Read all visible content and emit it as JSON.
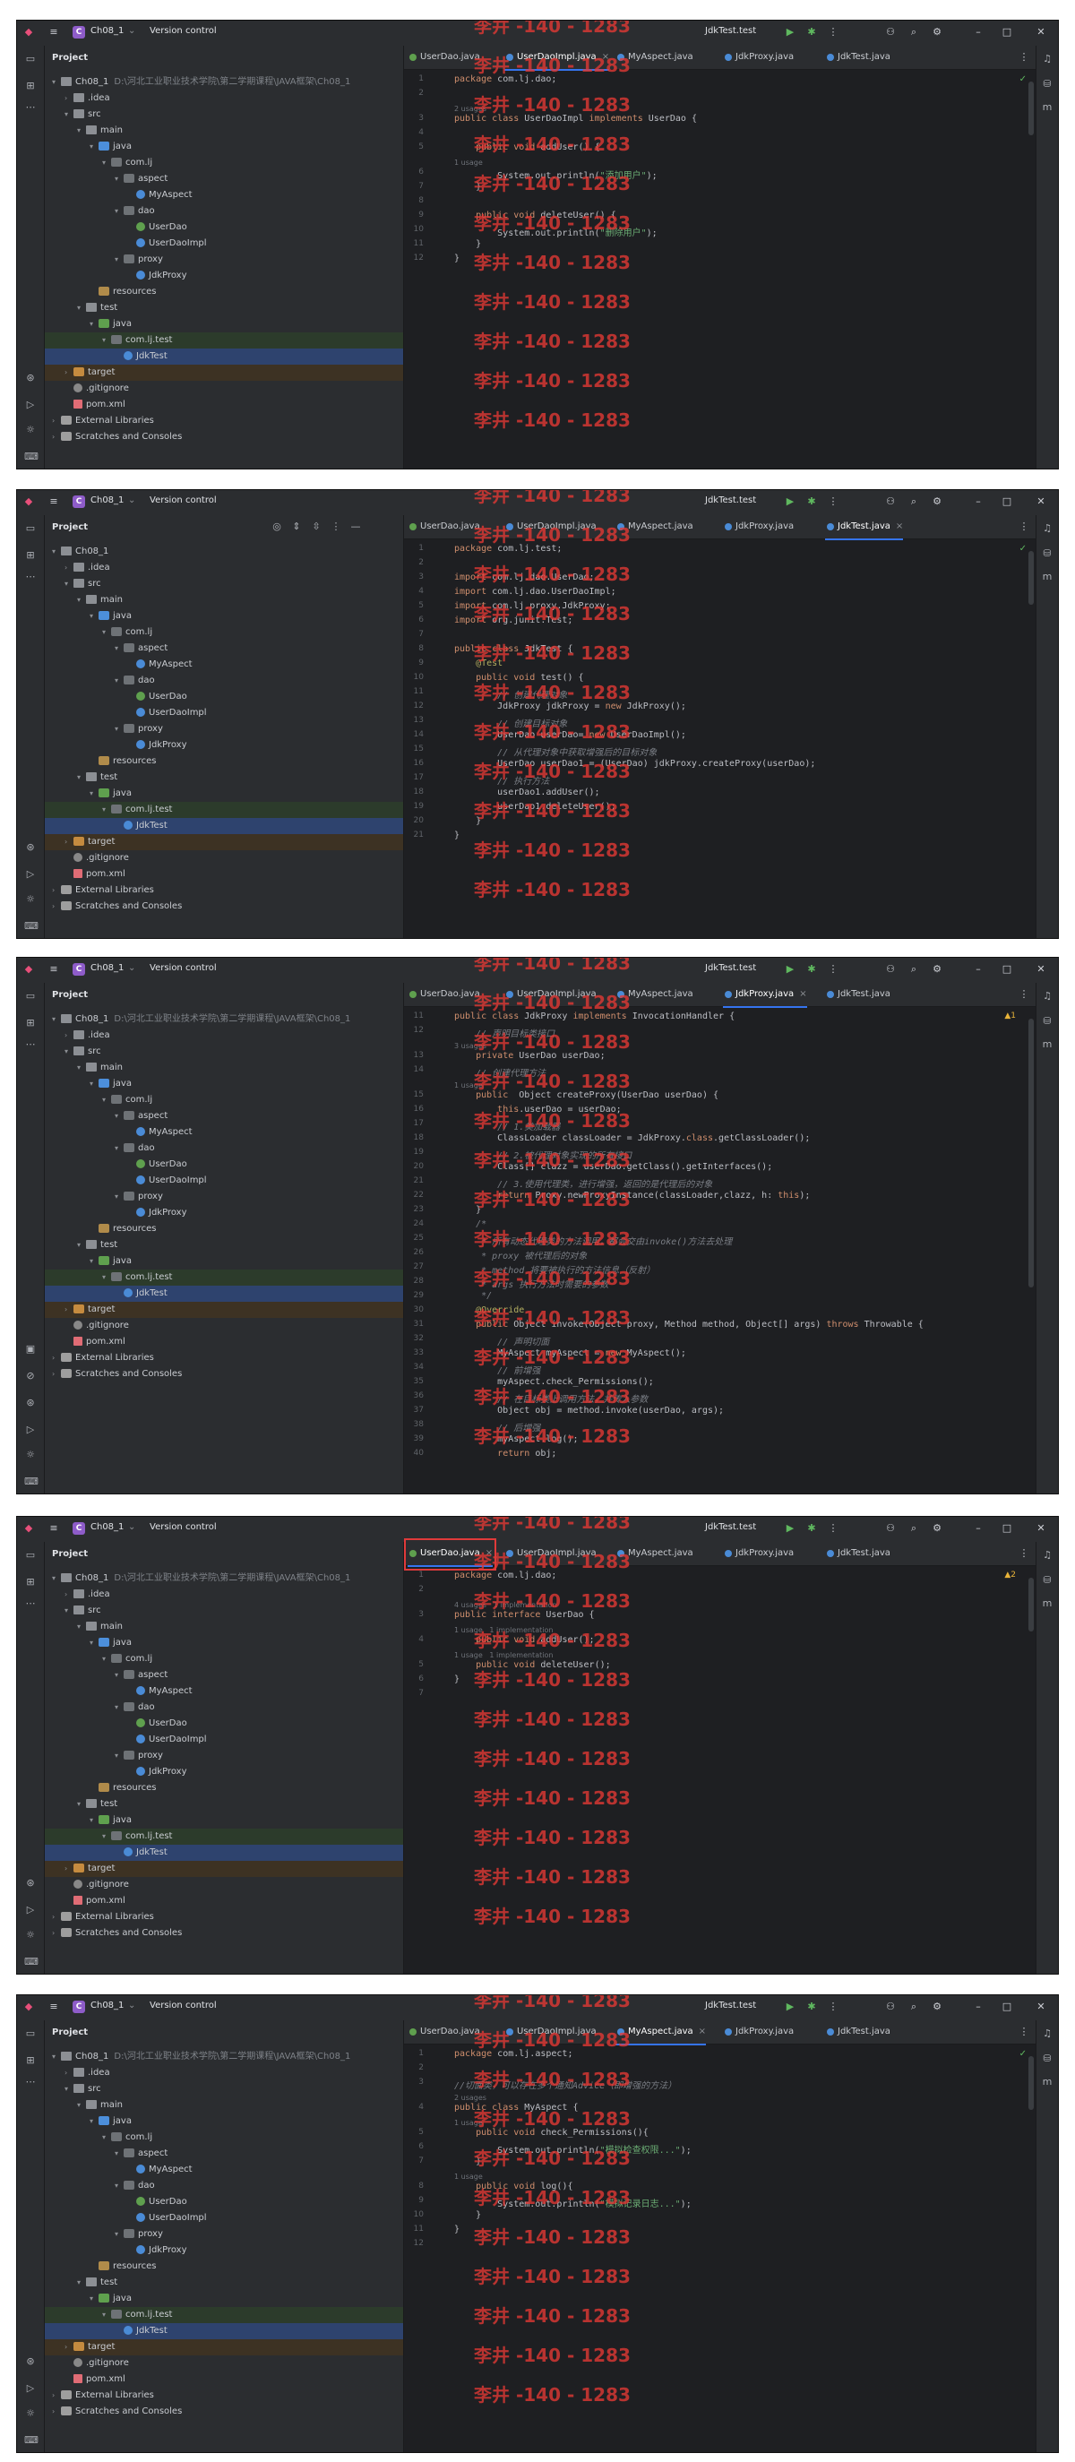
{
  "app": {
    "project_name": "Ch08_1",
    "project_badge": "C",
    "vcs_label": "Version control",
    "run_config": "JdkTest.test",
    "panel_title": "Project",
    "root_path": "D:\\河北工业职业技术学院\\第二学期课程\\JAVA框架\\Ch08_1"
  },
  "watermark": "李井 -140 - 1283",
  "tree": {
    "root": "Ch08_1",
    "idea": ".idea",
    "src": "src",
    "main": "main",
    "java": "java",
    "com_lj": "com.lj",
    "aspect": "aspect",
    "myaspect": "MyAspect",
    "dao": "dao",
    "userdao": "UserDao",
    "userdaoimpl": "UserDaoImpl",
    "proxy": "proxy",
    "jdkproxy": "JdkProxy",
    "resources": "resources",
    "test": "test",
    "test_java": "java",
    "com_lj_test": "com.lj.test",
    "jdktest": "JdkTest",
    "target": "target",
    "gitignore": ".gitignore",
    "pom": "pom.xml",
    "extlib": "External Libraries",
    "scratches": "Scratches and Consoles"
  },
  "tabs": [
    "UserDao.java",
    "UserDaoImpl.java",
    "MyAspect.java",
    "JdkProxy.java",
    "JdkTest.java"
  ],
  "panels": [
    {
      "active_tab": 1,
      "warn": "",
      "lines": [
        {
          "n": "1",
          "t": "package com.lj.dao;"
        },
        {
          "n": "2",
          "t": ""
        },
        {
          "hint": "2 usages"
        },
        {
          "n": "3",
          "t": "public class UserDaoImpl implements UserDao {"
        },
        {
          "n": "4",
          "t": ""
        },
        {
          "n": "5",
          "t": "    public void addUser() {"
        },
        {
          "hint": "1 usage"
        },
        {
          "n": "6",
          "t": "        System.out.println(\"添加用户\");"
        },
        {
          "n": "7",
          "t": "    }"
        },
        {
          "n": "8",
          "t": ""
        },
        {
          "n": "9",
          "t": "    public void deleteUser() {"
        },
        {
          "n": "10",
          "t": "        System.out.println(\"删除用户\");"
        },
        {
          "n": "11",
          "t": "    }"
        },
        {
          "n": "12",
          "t": "}"
        }
      ]
    },
    {
      "active_tab": 4,
      "warn": "",
      "lines": [
        {
          "n": "1",
          "t": "package com.lj.test;"
        },
        {
          "n": "2",
          "t": ""
        },
        {
          "n": "3",
          "t": "import com.lj.dao.UserDao;"
        },
        {
          "n": "4",
          "t": "import com.lj.dao.UserDaoImpl;"
        },
        {
          "n": "5",
          "t": "import com.lj.proxy.JdkProxy;"
        },
        {
          "n": "6",
          "t": "import org.junit.Test;"
        },
        {
          "n": "7",
          "t": ""
        },
        {
          "n": "8",
          "t": "public class JdkTest {"
        },
        {
          "n": "9",
          "t": "    @Test"
        },
        {
          "n": "10",
          "t": "    public void test() {"
        },
        {
          "n": "11",
          "t": "        // 创建代理对象"
        },
        {
          "n": "12",
          "t": "        JdkProxy jdkProxy = new JdkProxy();"
        },
        {
          "n": "13",
          "t": "        // 创建目标对象"
        },
        {
          "n": "14",
          "t": "        UserDao userDao= new UserDaoImpl();"
        },
        {
          "n": "15",
          "t": "        // 从代理对象中获取增强后的目标对象"
        },
        {
          "n": "16",
          "t": "        UserDao userDao1 = (UserDao) jdkProxy.createProxy(userDao);"
        },
        {
          "n": "17",
          "t": "        // 执行方法"
        },
        {
          "n": "18",
          "t": "        userDao1.addUser();"
        },
        {
          "n": "19",
          "t": "        userDao1.deleteUser();"
        },
        {
          "n": "20",
          "t": "    }"
        },
        {
          "n": "21",
          "t": "}"
        }
      ]
    },
    {
      "active_tab": 3,
      "warn": "▲1",
      "lines": [
        {
          "n": "11",
          "t": "public class JdkProxy implements InvocationHandler {"
        },
        {
          "n": "12",
          "t": "    // 声明目标类接口"
        },
        {
          "hint": "3 usages"
        },
        {
          "n": "13",
          "t": "    private UserDao userDao;"
        },
        {
          "n": "14",
          "t": "    // 创建代理方法"
        },
        {
          "hint": "1 usage"
        },
        {
          "n": "15",
          "t": "    public  Object createProxy(UserDao userDao) {"
        },
        {
          "n": "16",
          "t": "        this.userDao = userDao;"
        },
        {
          "n": "17",
          "t": "        // 1.类加载器"
        },
        {
          "n": "18",
          "t": "        ClassLoader classLoader = JdkProxy.class.getClassLoader();"
        },
        {
          "n": "19",
          "t": "        // 2.被代理对象实现的所有接口"
        },
        {
          "n": "20",
          "t": "        Class[] clazz = userDao.getClass().getInterfaces();"
        },
        {
          "n": "21",
          "t": "        // 3.使用代理类，进行增强，返回的是代理后的对象"
        },
        {
          "n": "22",
          "t": "        return Proxy.newProxyInstance(classLoader,clazz, h: this);"
        },
        {
          "n": "23",
          "t": "    }"
        },
        {
          "n": "24",
          "t": "    /*"
        },
        {
          "n": "25",
          "t": "     * 所有动态代理类的方法调用，都会交由invoke()方法去处理"
        },
        {
          "n": "26",
          "t": "     * proxy 被代理后的对象"
        },
        {
          "n": "27",
          "t": "     * method 将要被执行的方法信息（反射）"
        },
        {
          "n": "28",
          "t": "     * args 执行方法时需要的参数"
        },
        {
          "n": "29",
          "t": "     */"
        },
        {
          "n": "30",
          "t": "    @Override"
        },
        {
          "n": "31",
          "t": "    public Object invoke(Object proxy, Method method, Object[] args) throws Throwable {"
        },
        {
          "n": "32",
          "t": "        // 声明切面"
        },
        {
          "n": "33",
          "t": "        MyAspect myAspect = new MyAspect();"
        },
        {
          "n": "34",
          "t": "        // 前增强"
        },
        {
          "n": "35",
          "t": "        myAspect.check_Permissions();"
        },
        {
          "n": "36",
          "t": "        // 在目标类上调用方法，并传入参数"
        },
        {
          "n": "37",
          "t": "        Object obj = method.invoke(userDao, args);"
        },
        {
          "n": "38",
          "t": "        // 后增强"
        },
        {
          "n": "39",
          "t": "        myAspect.log();"
        },
        {
          "n": "40",
          "t": "        return obj;"
        }
      ]
    },
    {
      "active_tab": 0,
      "warn": "▲2",
      "lines": [
        {
          "n": "1",
          "t": "package com.lj.dao;"
        },
        {
          "n": "2",
          "t": ""
        },
        {
          "hint": "4 usages   1 implementation"
        },
        {
          "n": "3",
          "t": "public interface UserDao {"
        },
        {
          "hint": "1 usage   1 implementation"
        },
        {
          "n": "4",
          "t": "    public void addUser();"
        },
        {
          "hint": "1 usage   1 implementation"
        },
        {
          "n": "5",
          "t": "    public void deleteUser();"
        },
        {
          "n": "6",
          "t": "}"
        },
        {
          "n": "7",
          "t": ""
        }
      ]
    },
    {
      "active_tab": 2,
      "warn": "",
      "lines": [
        {
          "n": "1",
          "t": "package com.lj.aspect;"
        },
        {
          "n": "2",
          "t": ""
        },
        {
          "n": "3",
          "t": "//切面类，可以存在多个通知Advice（即增强的方法）"
        },
        {
          "hint": "2 usages"
        },
        {
          "n": "4",
          "t": "public class MyAspect {"
        },
        {
          "hint": "1 usage"
        },
        {
          "n": "5",
          "t": "    public void check_Permissions(){"
        },
        {
          "n": "6",
          "t": "        System.out.println(\"模拟检查权限...\");"
        },
        {
          "n": "7",
          "t": "    }"
        },
        {
          "hint": "1 usage"
        },
        {
          "n": "8",
          "t": "    public void log(){"
        },
        {
          "n": "9",
          "t": "        System.out.println(\"模拟记录日志...\");"
        },
        {
          "n": "10",
          "t": "    }"
        },
        {
          "n": "11",
          "t": "}"
        },
        {
          "n": "12",
          "t": ""
        }
      ]
    }
  ]
}
